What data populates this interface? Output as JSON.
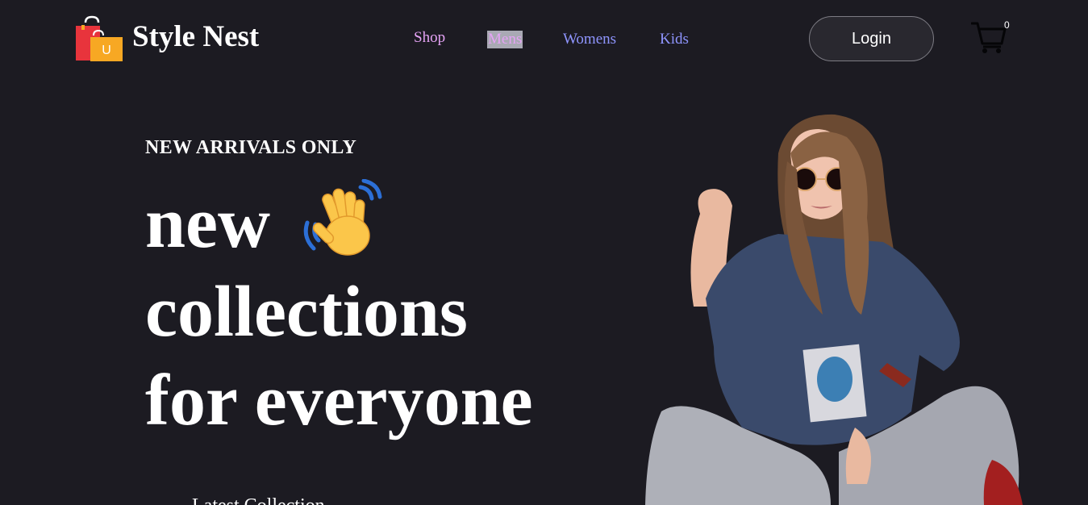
{
  "navbar": {
    "brand": "Style Nest",
    "logo_icon": "shopping-bags-icon",
    "links": [
      "Shop",
      "Mens",
      "Womens",
      "Kids"
    ],
    "active_link": "Mens",
    "login_label": "Login",
    "cart_icon": "cart-icon",
    "cart_count": "0"
  },
  "hero": {
    "eyebrow": "NEW ARRIVALS ONLY",
    "line1": "new",
    "line2": "collections",
    "line3": "for everyone",
    "wave_icon": "waving-hand-icon",
    "subtext": "Latest Collection"
  },
  "colors": {
    "background": "#1c1b22",
    "link_pink": "#e5a3f5",
    "link_blue": "#8f95ff",
    "active_highlight": "#a9a9b4",
    "bag_red": "#e8343c",
    "bag_yellow": "#f7a823",
    "hand_yellow": "#fbc64a"
  }
}
